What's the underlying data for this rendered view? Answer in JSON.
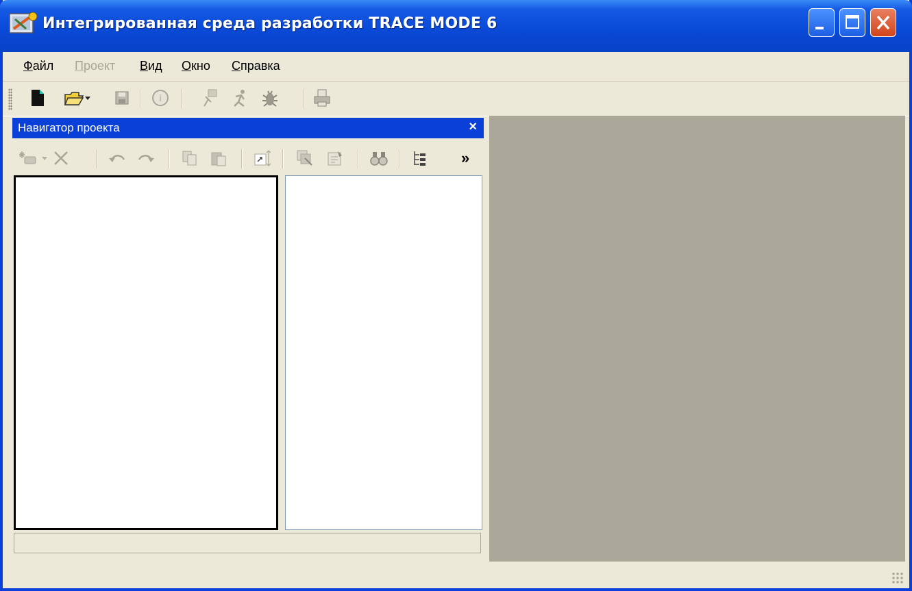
{
  "window": {
    "title": "Интегрированная среда разработки TRACE MODE 6"
  },
  "menu": {
    "file": "Файл",
    "project": "Проект",
    "view": "Вид",
    "window": "Окно",
    "help": "Справка"
  },
  "toolbar": {
    "icons": [
      "new-document-icon",
      "open-folder-icon",
      "dropdown-arrow-icon",
      "save-disk-icon",
      "info-icon",
      "run-icon",
      "running-man-icon",
      "debug-bug-icon",
      "print-icon"
    ]
  },
  "navigator": {
    "title": "Навигатор проекта",
    "close": "×",
    "overflow": "»",
    "icons": [
      "new-item-icon",
      "delete-icon",
      "undo-icon",
      "redo-icon",
      "copy-icon",
      "paste-icon",
      "link-icon",
      "group-copy-icon",
      "properties-icon",
      "find-binoculars-icon",
      "tree-view-icon"
    ]
  },
  "colors": {
    "titlebar": "#0a4ad8",
    "navigator_header": "#0a3fd8",
    "workspace": "#aca899",
    "chrome": "#ece9d8",
    "close_button": "#d2451c"
  }
}
